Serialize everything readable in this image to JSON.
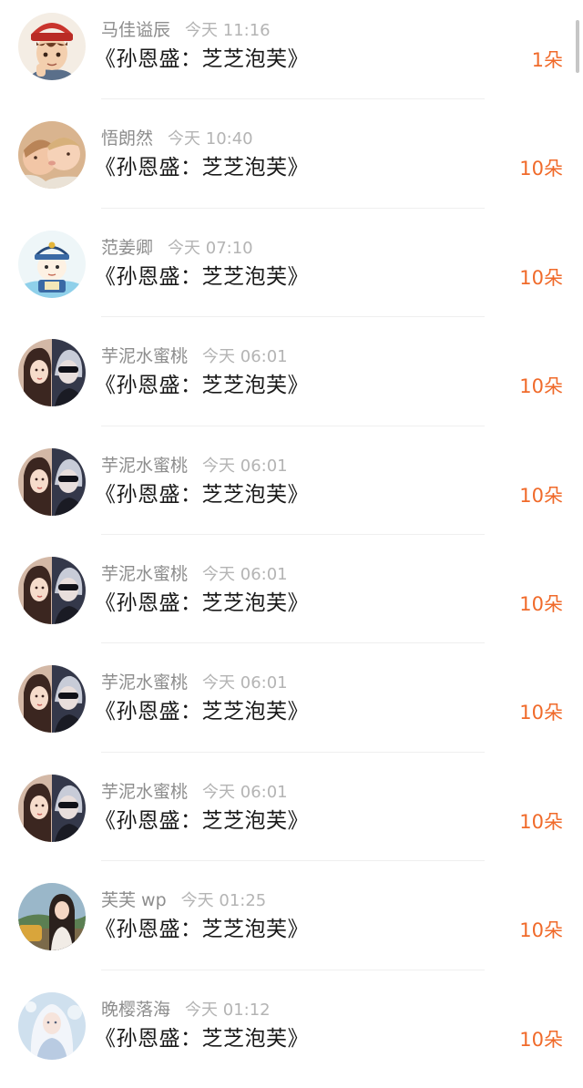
{
  "items": [
    {
      "name": "马佳谥辰",
      "time": "今天 11:16",
      "title": "《孙恩盛：芝芝泡芙》",
      "count": "1朵",
      "avatar": "cartoon-boy-red-cap"
    },
    {
      "name": "悟朗然",
      "time": "今天 10:40",
      "title": "《孙恩盛：芝芝泡芙》",
      "count": "10朵",
      "avatar": "two-babies-kissing"
    },
    {
      "name": "范姜卿",
      "time": "今天 07:10",
      "title": "《孙恩盛：芝芝泡芙》",
      "count": "10朵",
      "avatar": "cartoon-qing-official"
    },
    {
      "name": "芋泥水蜜桃",
      "time": "今天 06:01",
      "title": "《孙恩盛：芝芝泡芙》",
      "count": "10朵",
      "avatar": "couple-photo"
    },
    {
      "name": "芋泥水蜜桃",
      "time": "今天 06:01",
      "title": "《孙恩盛：芝芝泡芙》",
      "count": "10朵",
      "avatar": "couple-photo"
    },
    {
      "name": "芋泥水蜜桃",
      "time": "今天 06:01",
      "title": "《孙恩盛：芝芝泡芙》",
      "count": "10朵",
      "avatar": "couple-photo"
    },
    {
      "name": "芋泥水蜜桃",
      "time": "今天 06:01",
      "title": "《孙恩盛：芝芝泡芙》",
      "count": "10朵",
      "avatar": "couple-photo"
    },
    {
      "name": "芋泥水蜜桃",
      "time": "今天 06:01",
      "title": "《孙恩盛：芝芝泡芙》",
      "count": "10朵",
      "avatar": "couple-photo"
    },
    {
      "name": "芙芙 wp",
      "time": "今天 01:25",
      "title": "《孙恩盛：芝芝泡芙》",
      "count": "10朵",
      "avatar": "girl-outdoor-photo"
    },
    {
      "name": "晚樱落海",
      "time": "今天 01:12",
      "title": "《孙恩盛：芝芝泡芙》",
      "count": "10朵",
      "avatar": "fantasy-white-hair"
    }
  ],
  "colors": {
    "count": "#f06a2a",
    "name": "#8d8d8d",
    "time": "#b4b4b4",
    "title": "#1a1a1a",
    "divider": "#efefef"
  }
}
